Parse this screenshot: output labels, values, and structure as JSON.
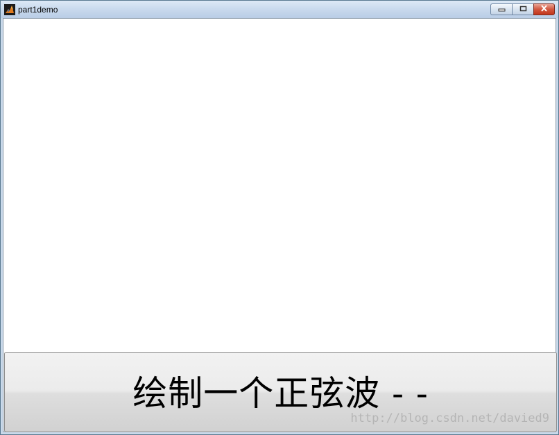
{
  "window": {
    "title": "part1demo",
    "icon": "matlab-icon",
    "controls": {
      "minimize_icon": "minimize-icon",
      "maximize_icon": "maximize-icon",
      "close_icon": "close-icon"
    }
  },
  "main": {
    "button_label": "绘制一个正弦波 - -"
  },
  "watermark": "http://blog.csdn.net/davied9",
  "colors": {
    "titlebar": "#c7d8ec",
    "close_button": "#c9452d",
    "button_face": "#e6e6e6"
  }
}
